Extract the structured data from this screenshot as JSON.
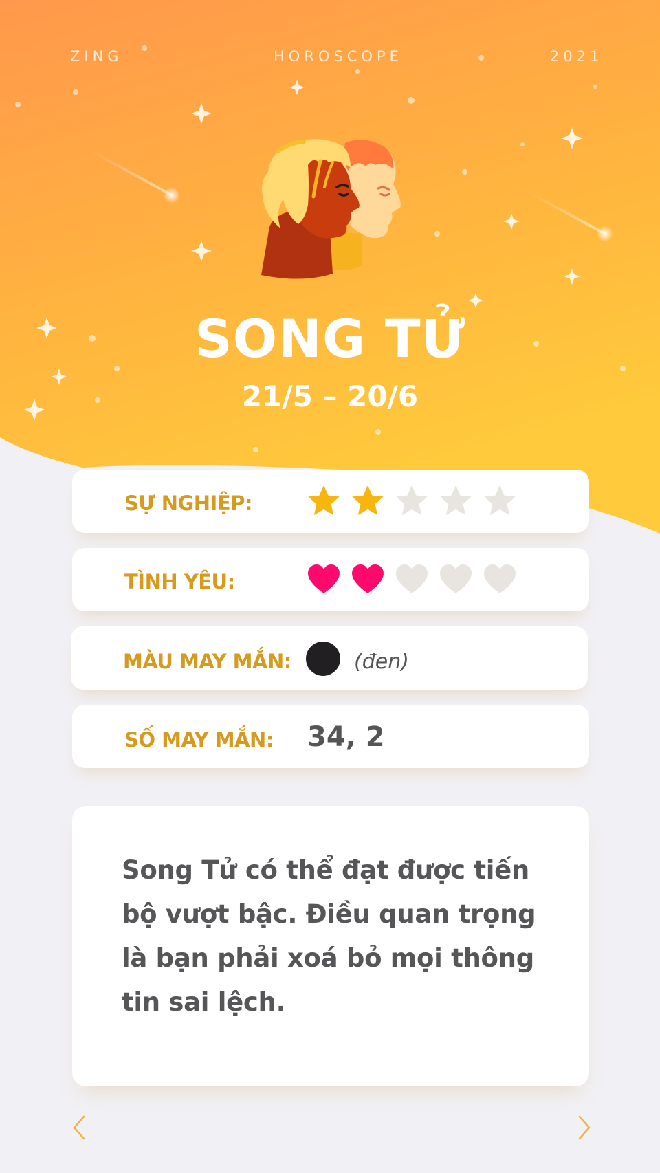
{
  "header": {
    "brand": "ZING",
    "section": "HOROSCOPE",
    "year": "2021"
  },
  "sign": {
    "name": "SONG TỬ",
    "dates": "21/5 – 20/6",
    "illustration": "gemini-twins-icon"
  },
  "stats": {
    "career": {
      "label": "SỰ NGHIỆP:",
      "rating": 2,
      "max": 5,
      "icon": "star-icon"
    },
    "love": {
      "label": "TÌNH YÊU:",
      "rating": 2,
      "max": 5,
      "icon": "heart-icon"
    },
    "lucky_color": {
      "label": "MÀU MAY MẮN:",
      "value": "(đen)",
      "swatch": "#211f21"
    },
    "lucky_number": {
      "label": "SỐ MAY MẮN:",
      "value": "34, 2"
    }
  },
  "description": "Song Tử có thể đạt được tiến bộ vượt bậc. Điều quan trọng là bạn phải xoá bỏ mọi thông tin sai lệch.",
  "navigation": {
    "prev": "chevron-left-icon",
    "next": "chevron-right-icon"
  },
  "colors": {
    "hero_top": "#ff9a4a",
    "hero_bottom": "#ffc53d",
    "label": "#d59a1e",
    "star_on": "#f8b40f",
    "heart_on": "#ff0a6c",
    "icon_off": "#e8e5e0",
    "nav": "#f2b23c"
  }
}
